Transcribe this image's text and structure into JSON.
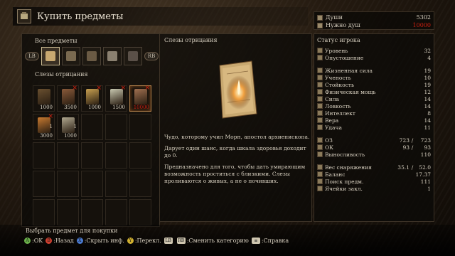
{
  "header": {
    "title": "Купить предметы"
  },
  "stats_box": {
    "souls_label": "Души",
    "souls_value": "5302",
    "needed_label": "Нужно душ",
    "needed_value": "10000",
    "needed_color": "#d02010"
  },
  "left_panel": {
    "category_label": "Все предметы",
    "lb": "LB",
    "rb": "RB",
    "selected_label": "Слезы отрицания",
    "items": [
      {
        "count": "",
        "price": "1000",
        "red": false,
        "x": false,
        "color": "#6a5030"
      },
      {
        "count": "",
        "price": "3500",
        "red": false,
        "x": true,
        "color": "#8a5a3a"
      },
      {
        "count": "",
        "price": "1000",
        "red": false,
        "x": true,
        "color": "#c8a050"
      },
      {
        "count": "",
        "price": "1500",
        "red": false,
        "x": true,
        "color": "#c8c8b0"
      },
      {
        "count": "",
        "price": "10000",
        "red": true,
        "x": true,
        "color": "#a07050"
      },
      {
        "count": "1",
        "price": "3000",
        "red": false,
        "x": true,
        "color": "#c87a30"
      },
      {
        "count": "1",
        "price": "1000",
        "red": false,
        "x": false,
        "color": "#b0a890"
      }
    ]
  },
  "description": {
    "title": "Слезы отрицания",
    "p1": "Чудо, которому учил Морн, апостол архиепископа.",
    "p2": "Дарует один шанс, когда шкала здоровья доходит до 0.",
    "p3": "Предназначено для того, чтобы дать умирающим возможность проститься с близкими. Слезы проливаются о живых, а не о почивших."
  },
  "status": {
    "title": "Статус игрока",
    "group1": [
      {
        "label": "Уровень",
        "value": "32"
      },
      {
        "label": "Опустошение",
        "value": "4"
      }
    ],
    "group2": [
      {
        "label": "Жизненная сила",
        "value": "19"
      },
      {
        "label": "Ученость",
        "value": "10"
      },
      {
        "label": "Стойкость",
        "value": "19"
      },
      {
        "label": "Физическая мощь",
        "value": "12"
      },
      {
        "label": "Сила",
        "value": "14"
      },
      {
        "label": "Ловкость",
        "value": "14"
      },
      {
        "label": "Интеллект",
        "value": "8"
      },
      {
        "label": "Вера",
        "value": "14"
      },
      {
        "label": "Удача",
        "value": "11"
      }
    ],
    "group3": [
      {
        "label": "ОЗ",
        "v1": "723",
        "v2": "723"
      },
      {
        "label": "ОК",
        "v1": "93",
        "v2": "93"
      },
      {
        "label": "Выносливость",
        "v1": "",
        "v2": "110"
      }
    ],
    "group4": [
      {
        "label": "Вес снаряжения",
        "v1": "35.1",
        "v2": "52.0"
      },
      {
        "label": "Баланс",
        "v1": "",
        "v2": "17.37"
      },
      {
        "label": "Поиск предм.",
        "v1": "",
        "v2": "111"
      },
      {
        "label": "Ячейки закл.",
        "v1": "",
        "v2": "1"
      }
    ]
  },
  "footer": {
    "hint": "Выбрать предмет для покупки",
    "controls": [
      {
        "btn": "A",
        "color": "#6ab04a",
        "label": ":OK"
      },
      {
        "btn": "B",
        "color": "#d04030",
        "label": ":Назад"
      },
      {
        "btn": "X",
        "color": "#4a7ad0",
        "label": ":Скрыть инф."
      },
      {
        "btn": "Y",
        "color": "#d0b030",
        "label": ":Перекл."
      },
      {
        "btn": "LB",
        "color": "#cfc6b0",
        "label": ""
      },
      {
        "btn": "RB",
        "color": "#cfc6b0",
        "label": ":Сменить категорию"
      },
      {
        "btn": "≡",
        "color": "#cfc6b0",
        "label": ":Справка"
      }
    ]
  }
}
